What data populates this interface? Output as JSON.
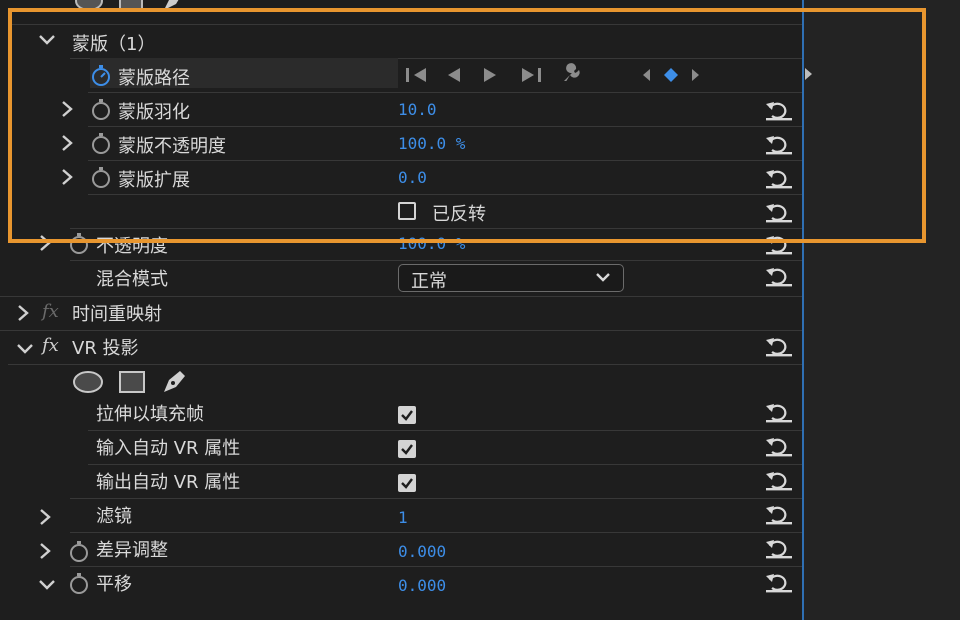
{
  "rows": {
    "shapes_top": {},
    "mask": {
      "label": "蒙版（1）"
    },
    "mask_path": {
      "label": "蒙版路径"
    },
    "mask_feather": {
      "label": "蒙版羽化",
      "value": "10.0"
    },
    "mask_opacity": {
      "label": "蒙版不透明度",
      "value": "100.0 %"
    },
    "mask_expansion": {
      "label": "蒙版扩展",
      "value": "0.0"
    },
    "inverted": {
      "label": "已反转"
    },
    "opacity": {
      "label": "不透明度",
      "value": "100.0 %"
    },
    "blend_mode": {
      "label": "混合模式",
      "value": "正常"
    },
    "time_remap": {
      "label": "时间重映射"
    },
    "vr_projection": {
      "label": "VR 投影"
    },
    "stretch_fill": {
      "label": "拉伸以填充帧",
      "checked": true
    },
    "auto_vr_in": {
      "label": "输入自动 VR 属性",
      "checked": true
    },
    "auto_vr_out": {
      "label": "输出自动 VR 属性",
      "checked": true
    },
    "filter": {
      "label": "滤镜",
      "value": "1"
    },
    "diff_adjust": {
      "label": "差异调整",
      "value": "0.000"
    },
    "pan": {
      "label": "平移",
      "value": "0.000"
    }
  },
  "colors": {
    "highlight": "#e8962f",
    "value_blue": "#3d8ee8",
    "playhead": "#2f6fb3"
  },
  "icons": [
    "chevron-down-icon",
    "chevron-right-icon",
    "stopwatch-icon",
    "reset-icon",
    "fx-icon",
    "ellipse-mask-icon",
    "rectangle-mask-icon",
    "pen-mask-icon",
    "wrench-icon",
    "keyframe-diamond-icon"
  ]
}
